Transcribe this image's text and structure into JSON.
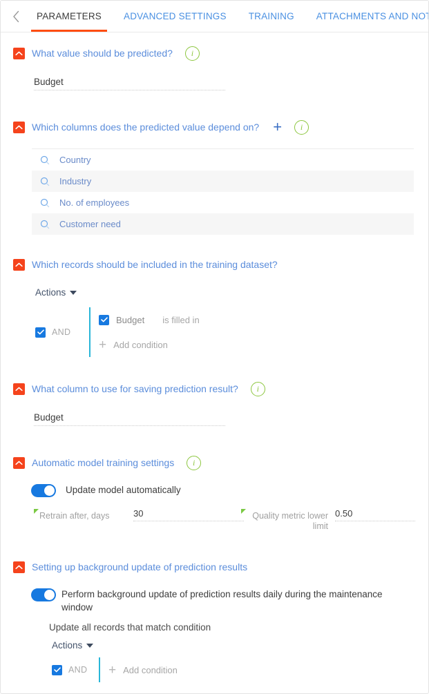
{
  "tabbar": {
    "prev_arrow": "chevron-left",
    "next_arrow": "chevron-right",
    "tabs": [
      {
        "label": "PARAMETERS",
        "active": true
      },
      {
        "label": "ADVANCED SETTINGS",
        "active": false
      },
      {
        "label": "TRAINING",
        "active": false
      },
      {
        "label": "ATTACHMENTS AND NOTES",
        "active": false
      }
    ]
  },
  "colors": {
    "accent_orange": "#ff4d12",
    "collapse_box": "#f5431c",
    "link_blue": "#5b8ddb",
    "info_green": "#8cc63e",
    "checkbox_blue": "#1779e0",
    "toggle_blue": "#1779e0",
    "condition_rail": "#29b6d8",
    "required_green": "#7ac943",
    "row_alt": "#f6f6f6"
  },
  "sections": {
    "predicted_value": {
      "title": "What value should be predicted?",
      "has_info": true,
      "field_value": "Budget"
    },
    "depends_on": {
      "title": "Which columns does the predicted value depend on?",
      "has_info": true,
      "has_add": true,
      "add_label": "+",
      "columns": [
        {
          "label": "Country"
        },
        {
          "label": "Industry"
        },
        {
          "label": "No. of employees"
        },
        {
          "label": "Customer need"
        }
      ]
    },
    "training_records": {
      "title": "Which records should be included in the training dataset?",
      "actions_label": "Actions",
      "and_label": "AND",
      "condition_field": "Budget",
      "condition_operator": "is filled in",
      "add_condition_label": "Add condition"
    },
    "saving_column": {
      "title": "What column to use for saving prediction result?",
      "has_info": true,
      "field_value": "Budget"
    },
    "auto_training": {
      "title": "Automatic model training settings",
      "has_info": true,
      "toggle_label": "Update model automatically",
      "toggle_on": true,
      "retrain_label": "Retrain after, days",
      "retrain_value": "30",
      "quality_label": "Quality metric lower limit",
      "quality_value": "0.50"
    },
    "background_update": {
      "title": "Setting up background update of prediction results",
      "toggle_label": "Perform background update of prediction results daily during the maintenance window",
      "toggle_on": true,
      "update_all_label": "Update all records that match condition",
      "actions_label": "Actions",
      "and_label": "AND",
      "add_condition_label": "Add condition"
    }
  },
  "icons": {
    "collapse": "chevron-up-icon",
    "info": "info-icon",
    "search": "search-icon",
    "check": "check-icon",
    "plus": "plus-icon",
    "caret": "caret-down-icon"
  }
}
